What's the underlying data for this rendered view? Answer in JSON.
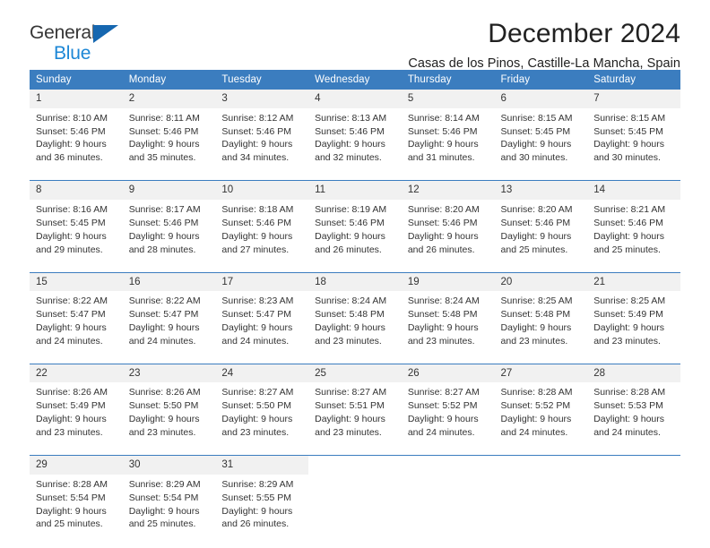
{
  "brand": {
    "word_one": "General",
    "word_two": "Blue",
    "accent_color": "#1c87d6",
    "triangle_color": "#1667b0"
  },
  "header": {
    "month_title": "December 2024",
    "location": "Casas de los Pinos, Castille-La Mancha, Spain"
  },
  "calendar": {
    "header_bg": "#3b7dbf",
    "daynum_bg": "#f1f1f1",
    "weekday_headers": [
      "Sunday",
      "Monday",
      "Tuesday",
      "Wednesday",
      "Thursday",
      "Friday",
      "Saturday"
    ],
    "weeks": [
      [
        {
          "day": "1",
          "sunrise": "Sunrise: 8:10 AM",
          "sunset": "Sunset: 5:46 PM",
          "daylight1": "Daylight: 9 hours",
          "daylight2": "and 36 minutes."
        },
        {
          "day": "2",
          "sunrise": "Sunrise: 8:11 AM",
          "sunset": "Sunset: 5:46 PM",
          "daylight1": "Daylight: 9 hours",
          "daylight2": "and 35 minutes."
        },
        {
          "day": "3",
          "sunrise": "Sunrise: 8:12 AM",
          "sunset": "Sunset: 5:46 PM",
          "daylight1": "Daylight: 9 hours",
          "daylight2": "and 34 minutes."
        },
        {
          "day": "4",
          "sunrise": "Sunrise: 8:13 AM",
          "sunset": "Sunset: 5:46 PM",
          "daylight1": "Daylight: 9 hours",
          "daylight2": "and 32 minutes."
        },
        {
          "day": "5",
          "sunrise": "Sunrise: 8:14 AM",
          "sunset": "Sunset: 5:46 PM",
          "daylight1": "Daylight: 9 hours",
          "daylight2": "and 31 minutes."
        },
        {
          "day": "6",
          "sunrise": "Sunrise: 8:15 AM",
          "sunset": "Sunset: 5:45 PM",
          "daylight1": "Daylight: 9 hours",
          "daylight2": "and 30 minutes."
        },
        {
          "day": "7",
          "sunrise": "Sunrise: 8:15 AM",
          "sunset": "Sunset: 5:45 PM",
          "daylight1": "Daylight: 9 hours",
          "daylight2": "and 30 minutes."
        }
      ],
      [
        {
          "day": "8",
          "sunrise": "Sunrise: 8:16 AM",
          "sunset": "Sunset: 5:45 PM",
          "daylight1": "Daylight: 9 hours",
          "daylight2": "and 29 minutes."
        },
        {
          "day": "9",
          "sunrise": "Sunrise: 8:17 AM",
          "sunset": "Sunset: 5:46 PM",
          "daylight1": "Daylight: 9 hours",
          "daylight2": "and 28 minutes."
        },
        {
          "day": "10",
          "sunrise": "Sunrise: 8:18 AM",
          "sunset": "Sunset: 5:46 PM",
          "daylight1": "Daylight: 9 hours",
          "daylight2": "and 27 minutes."
        },
        {
          "day": "11",
          "sunrise": "Sunrise: 8:19 AM",
          "sunset": "Sunset: 5:46 PM",
          "daylight1": "Daylight: 9 hours",
          "daylight2": "and 26 minutes."
        },
        {
          "day": "12",
          "sunrise": "Sunrise: 8:20 AM",
          "sunset": "Sunset: 5:46 PM",
          "daylight1": "Daylight: 9 hours",
          "daylight2": "and 26 minutes."
        },
        {
          "day": "13",
          "sunrise": "Sunrise: 8:20 AM",
          "sunset": "Sunset: 5:46 PM",
          "daylight1": "Daylight: 9 hours",
          "daylight2": "and 25 minutes."
        },
        {
          "day": "14",
          "sunrise": "Sunrise: 8:21 AM",
          "sunset": "Sunset: 5:46 PM",
          "daylight1": "Daylight: 9 hours",
          "daylight2": "and 25 minutes."
        }
      ],
      [
        {
          "day": "15",
          "sunrise": "Sunrise: 8:22 AM",
          "sunset": "Sunset: 5:47 PM",
          "daylight1": "Daylight: 9 hours",
          "daylight2": "and 24 minutes."
        },
        {
          "day": "16",
          "sunrise": "Sunrise: 8:22 AM",
          "sunset": "Sunset: 5:47 PM",
          "daylight1": "Daylight: 9 hours",
          "daylight2": "and 24 minutes."
        },
        {
          "day": "17",
          "sunrise": "Sunrise: 8:23 AM",
          "sunset": "Sunset: 5:47 PM",
          "daylight1": "Daylight: 9 hours",
          "daylight2": "and 24 minutes."
        },
        {
          "day": "18",
          "sunrise": "Sunrise: 8:24 AM",
          "sunset": "Sunset: 5:48 PM",
          "daylight1": "Daylight: 9 hours",
          "daylight2": "and 23 minutes."
        },
        {
          "day": "19",
          "sunrise": "Sunrise: 8:24 AM",
          "sunset": "Sunset: 5:48 PM",
          "daylight1": "Daylight: 9 hours",
          "daylight2": "and 23 minutes."
        },
        {
          "day": "20",
          "sunrise": "Sunrise: 8:25 AM",
          "sunset": "Sunset: 5:48 PM",
          "daylight1": "Daylight: 9 hours",
          "daylight2": "and 23 minutes."
        },
        {
          "day": "21",
          "sunrise": "Sunrise: 8:25 AM",
          "sunset": "Sunset: 5:49 PM",
          "daylight1": "Daylight: 9 hours",
          "daylight2": "and 23 minutes."
        }
      ],
      [
        {
          "day": "22",
          "sunrise": "Sunrise: 8:26 AM",
          "sunset": "Sunset: 5:49 PM",
          "daylight1": "Daylight: 9 hours",
          "daylight2": "and 23 minutes."
        },
        {
          "day": "23",
          "sunrise": "Sunrise: 8:26 AM",
          "sunset": "Sunset: 5:50 PM",
          "daylight1": "Daylight: 9 hours",
          "daylight2": "and 23 minutes."
        },
        {
          "day": "24",
          "sunrise": "Sunrise: 8:27 AM",
          "sunset": "Sunset: 5:50 PM",
          "daylight1": "Daylight: 9 hours",
          "daylight2": "and 23 minutes."
        },
        {
          "day": "25",
          "sunrise": "Sunrise: 8:27 AM",
          "sunset": "Sunset: 5:51 PM",
          "daylight1": "Daylight: 9 hours",
          "daylight2": "and 23 minutes."
        },
        {
          "day": "26",
          "sunrise": "Sunrise: 8:27 AM",
          "sunset": "Sunset: 5:52 PM",
          "daylight1": "Daylight: 9 hours",
          "daylight2": "and 24 minutes."
        },
        {
          "day": "27",
          "sunrise": "Sunrise: 8:28 AM",
          "sunset": "Sunset: 5:52 PM",
          "daylight1": "Daylight: 9 hours",
          "daylight2": "and 24 minutes."
        },
        {
          "day": "28",
          "sunrise": "Sunrise: 8:28 AM",
          "sunset": "Sunset: 5:53 PM",
          "daylight1": "Daylight: 9 hours",
          "daylight2": "and 24 minutes."
        }
      ],
      [
        {
          "day": "29",
          "sunrise": "Sunrise: 8:28 AM",
          "sunset": "Sunset: 5:54 PM",
          "daylight1": "Daylight: 9 hours",
          "daylight2": "and 25 minutes."
        },
        {
          "day": "30",
          "sunrise": "Sunrise: 8:29 AM",
          "sunset": "Sunset: 5:54 PM",
          "daylight1": "Daylight: 9 hours",
          "daylight2": "and 25 minutes."
        },
        {
          "day": "31",
          "sunrise": "Sunrise: 8:29 AM",
          "sunset": "Sunset: 5:55 PM",
          "daylight1": "Daylight: 9 hours",
          "daylight2": "and 26 minutes."
        },
        {
          "day": "",
          "sunrise": "",
          "sunset": "",
          "daylight1": "",
          "daylight2": ""
        },
        {
          "day": "",
          "sunrise": "",
          "sunset": "",
          "daylight1": "",
          "daylight2": ""
        },
        {
          "day": "",
          "sunrise": "",
          "sunset": "",
          "daylight1": "",
          "daylight2": ""
        },
        {
          "day": "",
          "sunrise": "",
          "sunset": "",
          "daylight1": "",
          "daylight2": ""
        }
      ]
    ]
  }
}
